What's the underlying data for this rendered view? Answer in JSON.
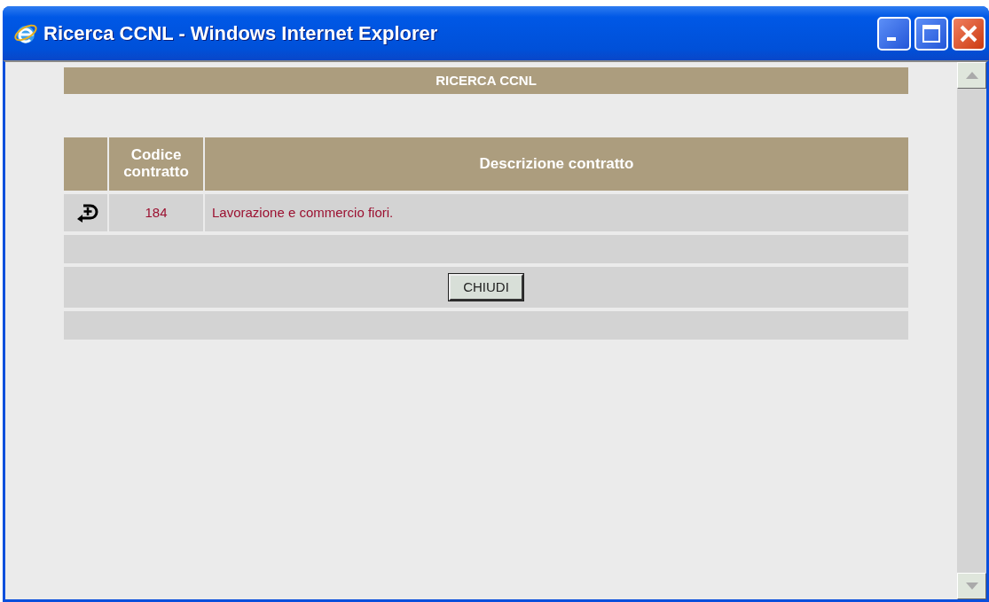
{
  "window": {
    "title": "Ricerca CCNL - Windows Internet Explorer"
  },
  "panel": {
    "title": "RICERCA CCNL"
  },
  "table": {
    "columns": [
      "Codice contratto",
      "Descrizione contratto"
    ],
    "rows": [
      {
        "code": "184",
        "description": "Lavorazione e commercio fiori."
      }
    ]
  },
  "buttons": [
    "CHIUDI"
  ]
}
